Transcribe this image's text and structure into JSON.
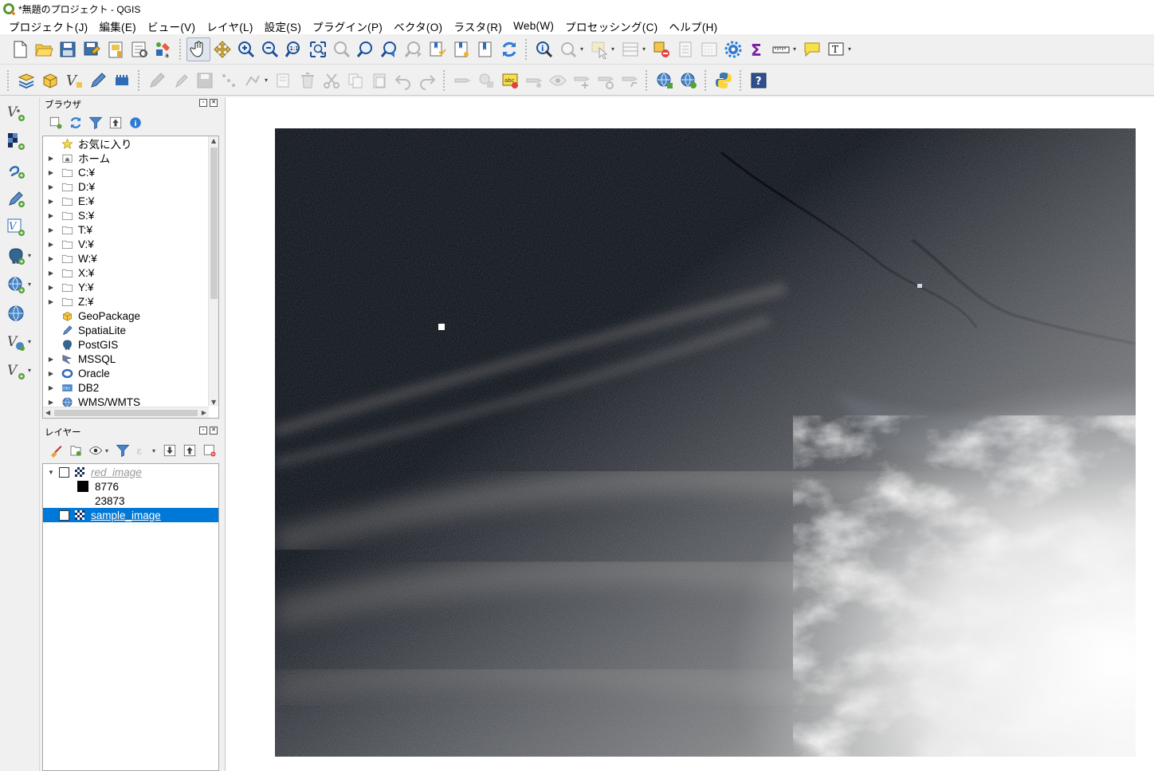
{
  "window": {
    "title": "*無題のプロジェクト - QGIS"
  },
  "menu": [
    "プロジェクト(J)",
    "編集(E)",
    "ビュー(V)",
    "レイヤ(L)",
    "設定(S)",
    "プラグイン(P)",
    "ベクタ(O)",
    "ラスタ(R)",
    "Web(W)",
    "プロセッシング(C)",
    "ヘルプ(H)"
  ],
  "browser_panel": {
    "title": "ブラウザ",
    "items": [
      "お気に入り",
      "ホーム",
      "C:¥",
      "D:¥",
      "E:¥",
      "S:¥",
      "T:¥",
      "V:¥",
      "W:¥",
      "X:¥",
      "Y:¥",
      "Z:¥",
      "GeoPackage",
      "SpatiaLite",
      "PostGIS",
      "MSSQL",
      "Oracle",
      "DB2",
      "WMS/WMTS"
    ]
  },
  "layers_panel": {
    "title": "レイヤー",
    "layers": [
      {
        "name": "red_image",
        "checked": false,
        "legend": [
          "8776",
          "23873"
        ]
      },
      {
        "name": "sample_image",
        "checked": true,
        "selected": true
      }
    ]
  },
  "colors": {
    "selection": "#0078d7",
    "qgis_green": "#589632",
    "qgis_orange": "#ee7913"
  },
  "icons": {
    "toolbar1": [
      "new-project-icon",
      "open-project-icon",
      "save-project-icon",
      "save-as-icon",
      "new-print-layout-icon",
      "layout-manager-icon",
      "style-manager-icon",
      "pan-icon",
      "pan-to-selection-icon",
      "zoom-in-icon",
      "zoom-out-icon",
      "zoom-native-icon",
      "zoom-full-icon",
      "zoom-to-selection-icon",
      "zoom-to-layer-icon",
      "zoom-last-icon",
      "zoom-next-icon",
      "new-bookmark-icon",
      "show-bookmarks-icon",
      "spatial-bookmark-icon",
      "refresh-icon",
      "identify-icon",
      "run-action-icon",
      "select-features-icon",
      "open-attribute-table-icon",
      "deselect-icon",
      "field-calculator-icon",
      "toolbox-icon",
      "statistics-icon",
      "measure-icon",
      "map-tips-icon",
      "text-annotation-icon"
    ],
    "toolbar2": [
      "layer-styling-icon",
      "digitize-icon",
      "new-vector-icon",
      "edit-pen-icon",
      "new-raster-icon",
      "toggle-edit-icon",
      "current-edits-icon",
      "save-edits-icon",
      "add-feature-icon",
      "vertex-tool-icon",
      "edit-attributes-icon",
      "delete-selected-icon",
      "cut-features-icon",
      "copy-features-icon",
      "paste-features-icon",
      "undo-icon",
      "redo-icon",
      "label-icon",
      "pin-labels-icon",
      "highlight-labels-icon",
      "label-settings-icon",
      "show-hide-labels-icon",
      "move-label-icon",
      "rotate-label-icon",
      "change-label-icon",
      "wms-icon",
      "wfs-icon",
      "python-icon",
      "help-icon"
    ],
    "left": [
      "add-vector-layer-icon",
      "add-raster-layer-icon",
      "add-mesh-layer-icon",
      "add-delimited-text-icon",
      "add-spatialite-icon",
      "add-postgis-icon",
      "add-wms-icon",
      "add-wcs-icon",
      "add-wfs-icon",
      "new-vector-icon"
    ]
  }
}
